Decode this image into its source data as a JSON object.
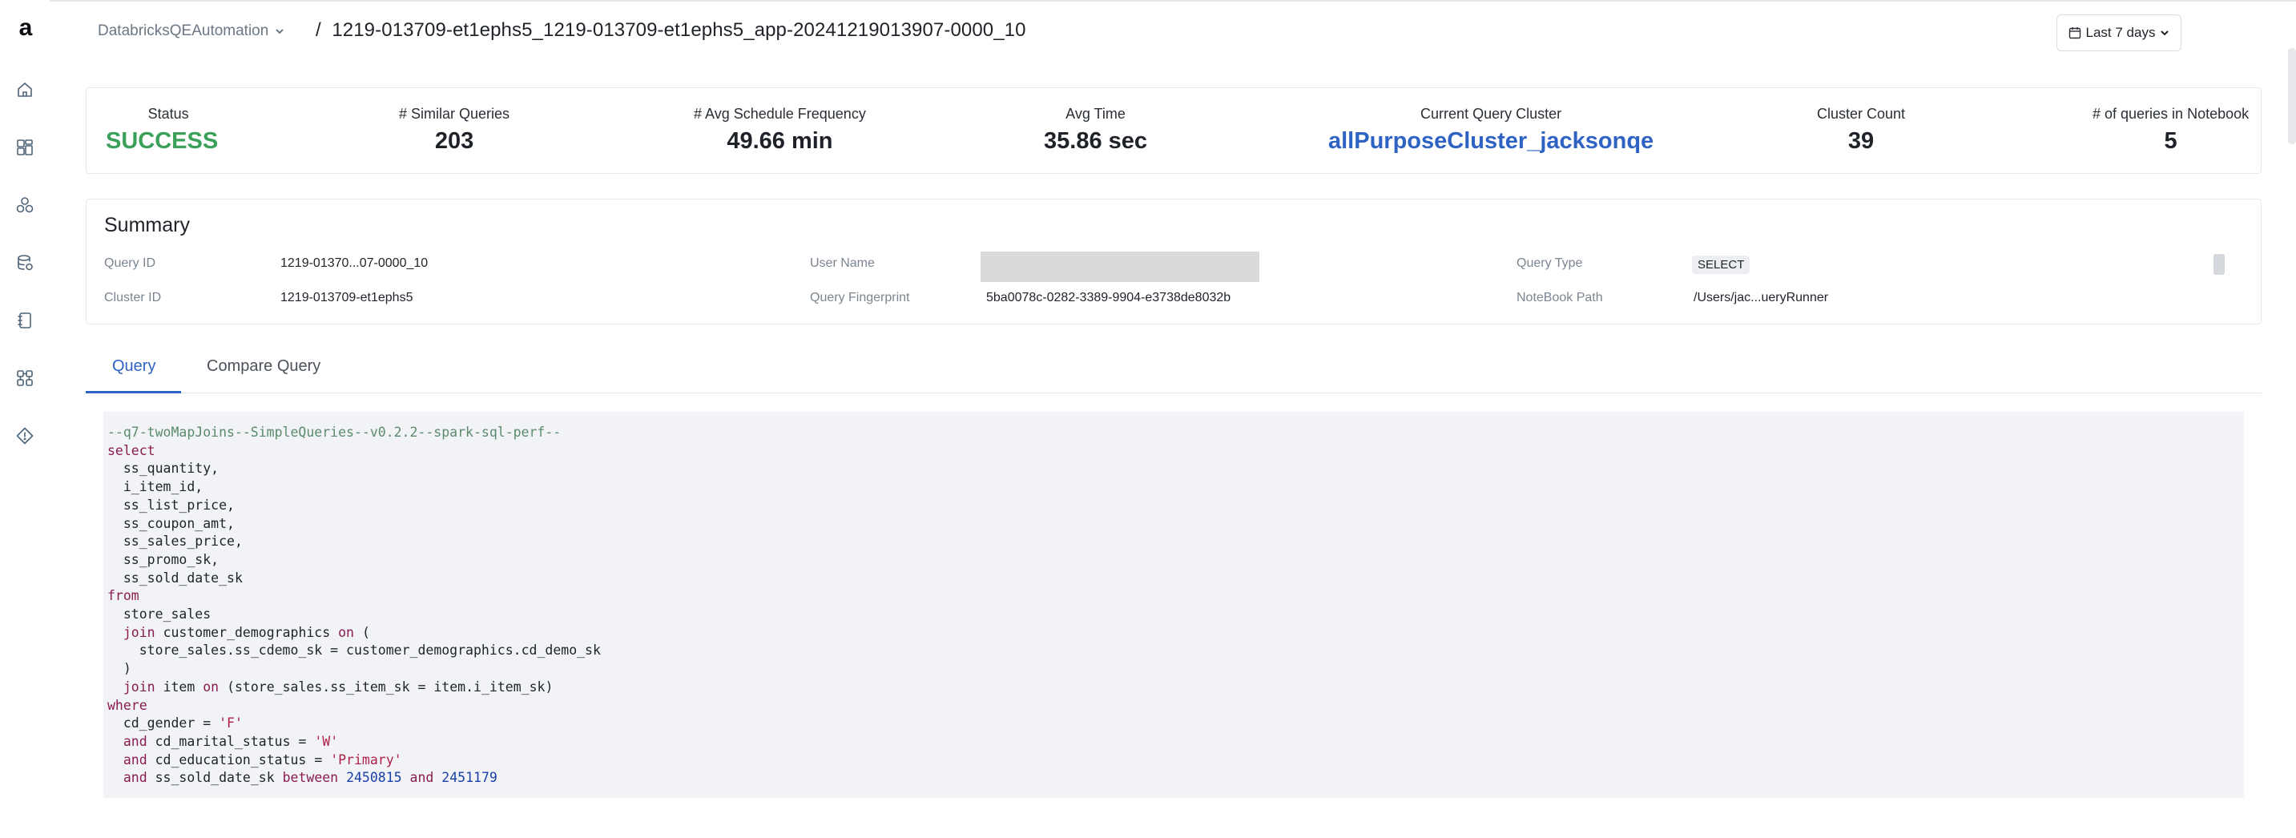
{
  "app": {
    "logo": "a"
  },
  "sidebar": {
    "items": [
      {
        "name": "home",
        "icon": "home-icon"
      },
      {
        "name": "dashboards",
        "icon": "dashboard-icon"
      },
      {
        "name": "clusters",
        "icon": "cluster-icon"
      },
      {
        "name": "data",
        "icon": "database-icon"
      },
      {
        "name": "notebooks",
        "icon": "notebook-icon"
      },
      {
        "name": "workflows",
        "icon": "workflow-icon"
      },
      {
        "name": "policies",
        "icon": "diamond-icon"
      }
    ]
  },
  "header": {
    "workspace": "DatabricksQEAutomation",
    "separator": "/",
    "title": "1219-013709-et1ephs5_1219-013709-et1ephs5_app-20241219013907-0000_10",
    "date_range": "Last 7 days"
  },
  "stats": {
    "status": {
      "label": "Status",
      "value": "SUCCESS"
    },
    "similar_queries": {
      "label": "# Similar Queries",
      "value": "203"
    },
    "avg_schedule_frequency": {
      "label": "# Avg Schedule Frequency",
      "value": "49.66 min"
    },
    "avg_time": {
      "label": "Avg Time",
      "value": "35.86 sec"
    },
    "current_query_cluster": {
      "label": "Current Query Cluster",
      "value": "allPurposeCluster_jacksonqe"
    },
    "cluster_count": {
      "label": "Cluster Count",
      "value": "39"
    },
    "queries_in_notebook": {
      "label": "# of queries in Notebook",
      "value": "5"
    }
  },
  "summary": {
    "title": "Summary",
    "query_id": {
      "label": "Query ID",
      "value": "1219-01370...07-0000_10"
    },
    "cluster_id": {
      "label": "Cluster ID",
      "value": "1219-013709-et1ephs5"
    },
    "user_name": {
      "label": "User Name",
      "value": ""
    },
    "query_fingerprint": {
      "label": "Query Fingerprint",
      "value": "5ba0078c-0282-3389-9904-e3738de8032b"
    },
    "query_type": {
      "label": "Query Type",
      "value": "SELECT"
    },
    "notebook_path": {
      "label": "NoteBook Path",
      "value": "/Users/jac...ueryRunner"
    }
  },
  "tabs": [
    {
      "label": "Query",
      "active": true
    },
    {
      "label": "Compare Query",
      "active": false
    }
  ],
  "query_code": {
    "lines": [
      "--q7-twoMapJoins--SimpleQueries--v0.2.2--spark-sql-perf--",
      "select",
      "  ss_quantity,",
      "  i_item_id,",
      "  ss_list_price,",
      "  ss_coupon_amt,",
      "  ss_sales_price,",
      "  ss_promo_sk,",
      "  ss_sold_date_sk",
      "from",
      "  store_sales",
      "  join customer_demographics on (",
      "    store_sales.ss_cdemo_sk = customer_demographics.cd_demo_sk",
      "  )",
      "  join item on (store_sales.ss_item_sk = item.i_item_sk)",
      "where",
      "  cd_gender = 'F'",
      "  and cd_marital_status = 'W'",
      "  and cd_education_status = 'Primary'",
      "  and ss_sold_date_sk between 2450815 and 2451179"
    ]
  },
  "colors": {
    "accent": "#2e63c4",
    "success": "#3ba15a",
    "code_bg": "#f1f3f6",
    "keyword": "#8a1c50",
    "comment": "#5b8b6b",
    "string": "#b0214a",
    "number": "#1b3fa8"
  }
}
